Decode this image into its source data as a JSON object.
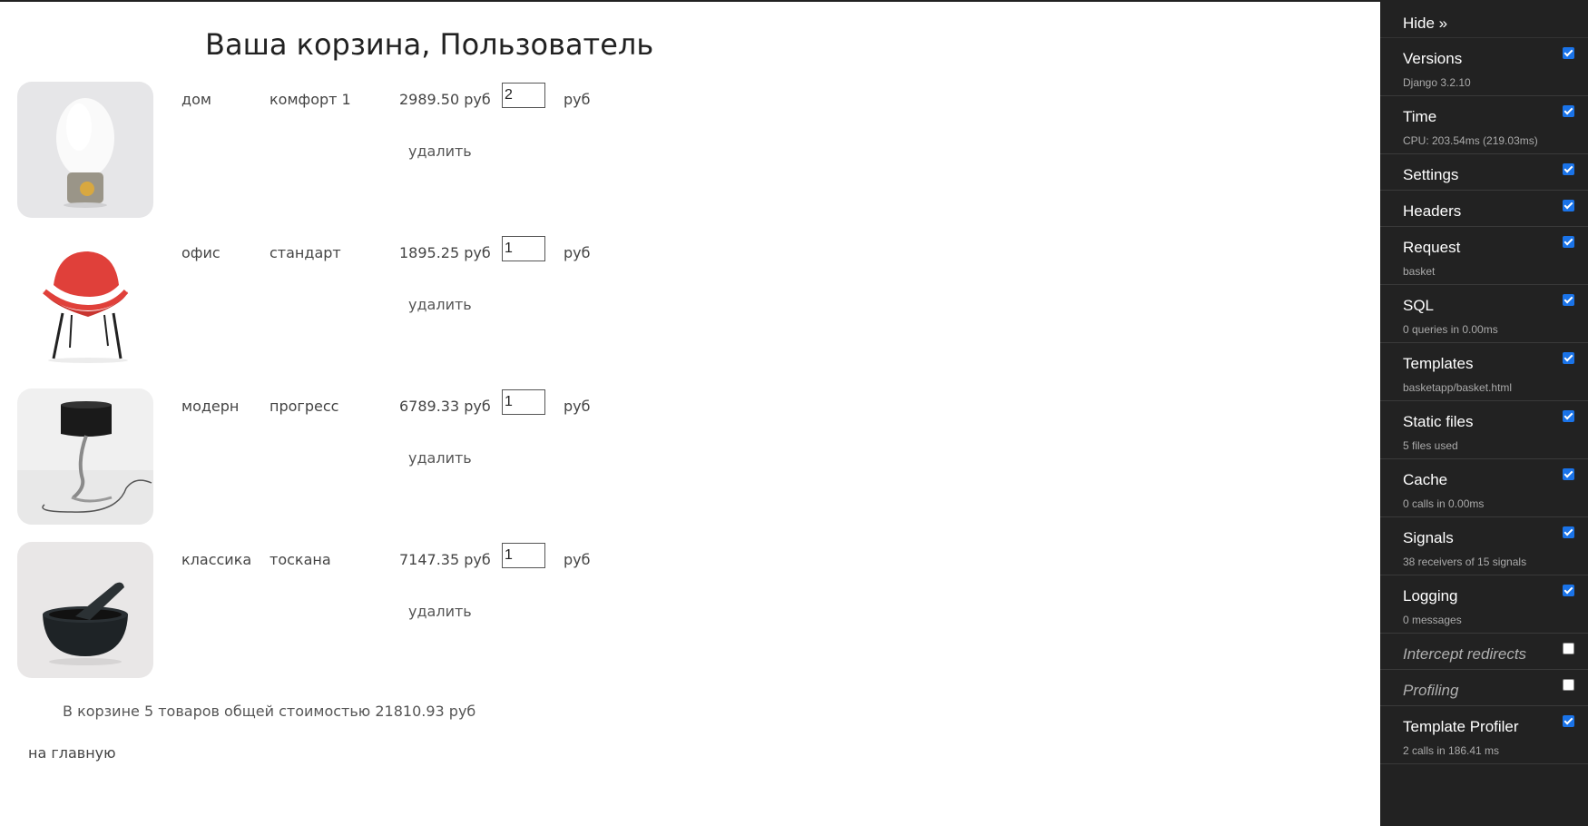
{
  "page_title": "Ваша корзина, Пользователь",
  "items": [
    {
      "category": "дом",
      "name": "комфорт 1",
      "price": "2989.50 руб",
      "qty": "2",
      "currency": "руб",
      "delete_label": "удалить",
      "image": "lamp-icon"
    },
    {
      "category": "офис",
      "name": "стандарт",
      "price": "1895.25 руб",
      "qty": "1",
      "currency": "руб",
      "delete_label": "удалить",
      "image": "chair-icon"
    },
    {
      "category": "модерн",
      "name": "прогресс",
      "price": "6789.33 руб",
      "qty": "1",
      "currency": "руб",
      "delete_label": "удалить",
      "image": "table-lamp-icon"
    },
    {
      "category": "классика",
      "name": "тоскана",
      "price": "7147.35 руб",
      "qty": "1",
      "currency": "руб",
      "delete_label": "удалить",
      "image": "mortar-icon"
    }
  ],
  "summary": "В корзине 5 товаров общей стоимостью 21810.93 руб",
  "home_link": "на главную",
  "toolbar": {
    "hide_label": "Hide »",
    "panels": [
      {
        "title": "Versions",
        "subtitle": "Django 3.2.10",
        "checked": true
      },
      {
        "title": "Time",
        "subtitle": "CPU: 203.54ms (219.03ms)",
        "checked": true
      },
      {
        "title": "Settings",
        "subtitle": "",
        "checked": true
      },
      {
        "title": "Headers",
        "subtitle": "",
        "checked": true
      },
      {
        "title": "Request",
        "subtitle": "basket",
        "checked": true
      },
      {
        "title": "SQL",
        "subtitle": "0 queries in 0.00ms",
        "checked": true
      },
      {
        "title": "Templates",
        "subtitle": "basketapp/basket.html",
        "checked": true
      },
      {
        "title": "Static files",
        "subtitle": "5 files used",
        "checked": true
      },
      {
        "title": "Cache",
        "subtitle": "0 calls in 0.00ms",
        "checked": true
      },
      {
        "title": "Signals",
        "subtitle": "38 receivers of 15 signals",
        "checked": true
      },
      {
        "title": "Logging",
        "subtitle": "0 messages",
        "checked": true
      },
      {
        "title": "Intercept redirects",
        "subtitle": "",
        "checked": false
      },
      {
        "title": "Profiling",
        "subtitle": "",
        "checked": false
      },
      {
        "title": "Template Profiler",
        "subtitle": "2 calls in 186.41 ms",
        "checked": true
      }
    ]
  },
  "colors": {
    "toolbar_bg": "#222222",
    "checkbox_on": "#1a73e8",
    "chair_red": "#e0403a"
  }
}
